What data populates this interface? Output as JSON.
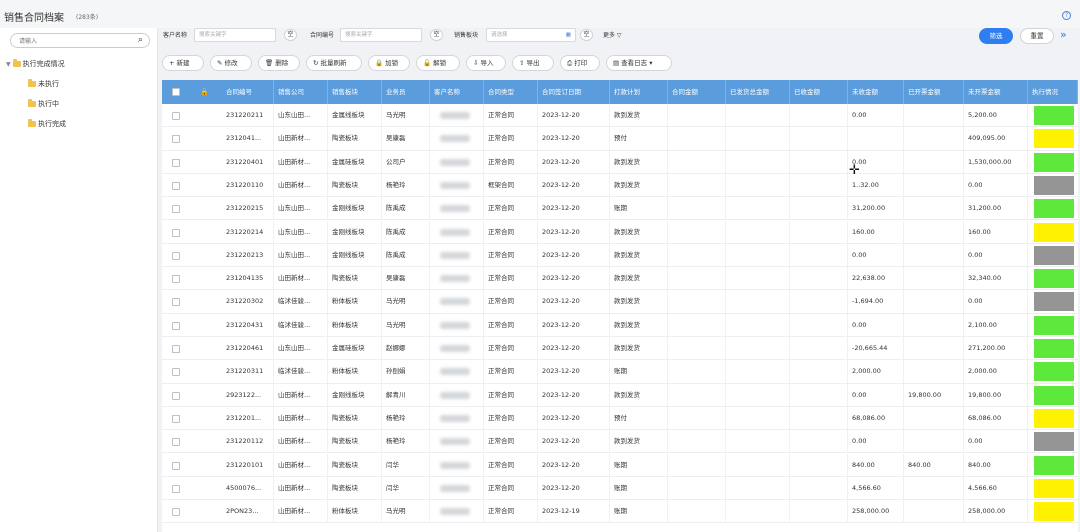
{
  "title": "销售合同档案",
  "count": "(283条)",
  "tree": {
    "search_placeholder": "请输入",
    "root": "执行完成情况",
    "children": [
      "未执行",
      "执行中",
      "执行完成"
    ]
  },
  "filters": {
    "customer_label": "客户名称",
    "customer_placeholder": "搜索关键字",
    "contract_label": "合同编号",
    "contract_placeholder": "搜索关键字",
    "segment_label": "销售板块",
    "segment_placeholder": "请选择",
    "empty_btn": "空",
    "more": "更多 ▽",
    "filter_btn": "筛选",
    "reset_btn": "重置"
  },
  "toolbar": [
    {
      "icon": "+",
      "label": "新建",
      "name": "new-button"
    },
    {
      "icon": "✎",
      "label": "修改",
      "name": "edit-button"
    },
    {
      "icon": "🗑",
      "label": "删除",
      "name": "delete-button"
    },
    {
      "icon": "↻",
      "label": "批量刷新",
      "name": "batch-refresh-button"
    },
    {
      "icon": "🔒",
      "label": "加锁",
      "name": "lock-button"
    },
    {
      "icon": "🔓",
      "label": "解锁",
      "name": "unlock-button"
    },
    {
      "icon": "⇩",
      "label": "导入",
      "name": "import-button"
    },
    {
      "icon": "⇧",
      "label": "导出",
      "name": "export-button"
    },
    {
      "icon": "⎙",
      "label": "打印",
      "name": "print-button"
    },
    {
      "icon": "▤",
      "label": "查看日志 ▾",
      "name": "view-log-button"
    }
  ],
  "columns": [
    "合同编号",
    "销售公司",
    "销售板块",
    "业务员",
    "客户名称",
    "合同类型",
    "合同签订日期",
    "打款计划",
    "合同金额",
    "已发货总金额",
    "已收金额",
    "未收金额",
    "已开票金额",
    "未开票金额",
    "执行情况"
  ],
  "rows": [
    {
      "no": "23122021​1",
      "company": "山东山田...",
      "segment": "金属线板块",
      "sales": "马光明",
      "type": "正常合同",
      "date": "2023-12-20",
      "plan": "款到发货",
      "unrecv": "0.00",
      "invoiced": "",
      "uninvoiced": "5,200.00",
      "status": "#5ee83c"
    },
    {
      "no": "2312041...",
      "company": "山田新材...",
      "segment": "陶瓷板块",
      "sales": "吴康磊",
      "type": "正常合同",
      "date": "2023-12-20",
      "plan": "预付",
      "unrecv": "",
      "invoiced": "",
      "uninvoiced": "409,095.00",
      "status": "#fff200"
    },
    {
      "no": "231220401",
      "company": "山田新材...",
      "segment": "金属硅板块",
      "sales": "公司户",
      "type": "正常合同",
      "date": "2023-12-20",
      "plan": "款到发货",
      "unrecv": "0.00",
      "invoiced": "",
      "uninvoiced": "1,530,000.00",
      "status": "#5ee83c"
    },
    {
      "no": "231220110",
      "company": "山田新材...",
      "segment": "陶瓷板块",
      "sales": "杨艳玲",
      "type": "框架合同",
      "date": "2023-12-20",
      "plan": "款到发货",
      "unrecv": "1..32.00",
      "invoiced": "",
      "uninvoiced": "0.00",
      "status": "#959595"
    },
    {
      "no": "231220215",
      "company": "山东山田...",
      "segment": "金刚线板块",
      "sales": "陈禹成",
      "type": "正常合同",
      "date": "2023-12-20",
      "plan": "账期",
      "unrecv": "31,200.00",
      "invoiced": "",
      "uninvoiced": "31,200.00",
      "status": "#5ee83c"
    },
    {
      "no": "231220214",
      "company": "山东山田...",
      "segment": "金刚线板块",
      "sales": "陈禹成",
      "type": "正常合同",
      "date": "2023-12-20",
      "plan": "款到发货",
      "unrecv": "160.00",
      "invoiced": "",
      "uninvoiced": "160.00",
      "status": "#fff200"
    },
    {
      "no": "231220213",
      "company": "山东山田...",
      "segment": "金刚线板块",
      "sales": "陈禹成",
      "type": "正常合同",
      "date": "2023-12-20",
      "plan": "款到发货",
      "unrecv": "0.00",
      "invoiced": "",
      "uninvoiced": "0.00",
      "status": "#959595"
    },
    {
      "no": "231204135",
      "company": "山田新材...",
      "segment": "陶瓷板块",
      "sales": "吴康磊",
      "type": "正常合同",
      "date": "2023-12-20",
      "plan": "款到发货",
      "unrecv": "22,638.00",
      "invoiced": "",
      "uninvoiced": "32,340.00",
      "status": "#5ee83c"
    },
    {
      "no": "231220302",
      "company": "临沭佳骏...",
      "segment": "粉体板块",
      "sales": "马光明",
      "type": "正常合同",
      "date": "2023-12-20",
      "plan": "款到发货",
      "unrecv": "-1,694.00",
      "invoiced": "",
      "uninvoiced": "0.00",
      "status": "#959595"
    },
    {
      "no": "231220431",
      "company": "临沭佳骏...",
      "segment": "粉体板块",
      "sales": "马光明",
      "type": "正常合同",
      "date": "2023-12-20",
      "plan": "款到发货",
      "unrecv": "0.00",
      "invoiced": "",
      "uninvoiced": "2,100.00",
      "status": "#5ee83c"
    },
    {
      "no": "231220461",
      "company": "山东山田...",
      "segment": "金属硅板块",
      "sales": "赵娜娜",
      "type": "正常合同",
      "date": "2023-12-20",
      "plan": "款到发货",
      "unrecv": "-20,665.44",
      "invoiced": "",
      "uninvoiced": "271,200.00",
      "status": "#5ee83c"
    },
    {
      "no": "231220311",
      "company": "临沭佳骏...",
      "segment": "粉体板块",
      "sales": "孙刨娟",
      "type": "正常合同",
      "date": "2023-12-20",
      "plan": "账期",
      "unrecv": "2,000.00",
      "invoiced": "",
      "uninvoiced": "2,000.00",
      "status": "#5ee83c"
    },
    {
      "no": "2923122...",
      "company": "山田新材...",
      "segment": "金刚线板块",
      "sales": "解青川",
      "type": "正常合同",
      "date": "2023-12-20",
      "plan": "款到发货",
      "unrecv": "0.00",
      "invoiced": "19,800.00",
      "uninvoiced": "19,800.00",
      "status": "#5ee83c"
    },
    {
      "no": "2312201...",
      "company": "山田新材...",
      "segment": "陶瓷板块",
      "sales": "杨艳玲",
      "type": "正常合同",
      "date": "2023-12-20",
      "plan": "预付",
      "unrecv": "68,086.00",
      "invoiced": "",
      "uninvoiced": "68,086.00",
      "status": "#fff200"
    },
    {
      "no": "231220112",
      "company": "山田新材...",
      "segment": "陶瓷板块",
      "sales": "杨艳玲",
      "type": "正常合同",
      "date": "2023-12-20",
      "plan": "款到发货",
      "unrecv": "0.00",
      "invoiced": "",
      "uninvoiced": "0.00",
      "status": "#959595"
    },
    {
      "no": "231220101",
      "company": "山田新材...",
      "segment": "陶瓷板块",
      "sales": "闫华",
      "type": "正常合同",
      "date": "2023-12-20",
      "plan": "账期",
      "unrecv": "840.00",
      "invoiced": "840.00",
      "uninvoiced": "840.00",
      "status": "#5ee83c"
    },
    {
      "no": "4500076...",
      "company": "山田新材...",
      "segment": "陶瓷板块",
      "sales": "闫华",
      "type": "正常合同",
      "date": "2023-12-20",
      "plan": "账期",
      "unrecv": "4,566.60",
      "invoiced": "",
      "uninvoiced": "4,566.60",
      "status": "#fff200"
    },
    {
      "no": "2PON23...",
      "company": "山田新材...",
      "segment": "粉体板块",
      "sales": "马光明",
      "type": "正常合同",
      "date": "2023-12-19",
      "plan": "账期",
      "unrecv": "258,000.00",
      "invoiced": "",
      "uninvoiced": "258,000.00",
      "status": "#fff200"
    }
  ]
}
